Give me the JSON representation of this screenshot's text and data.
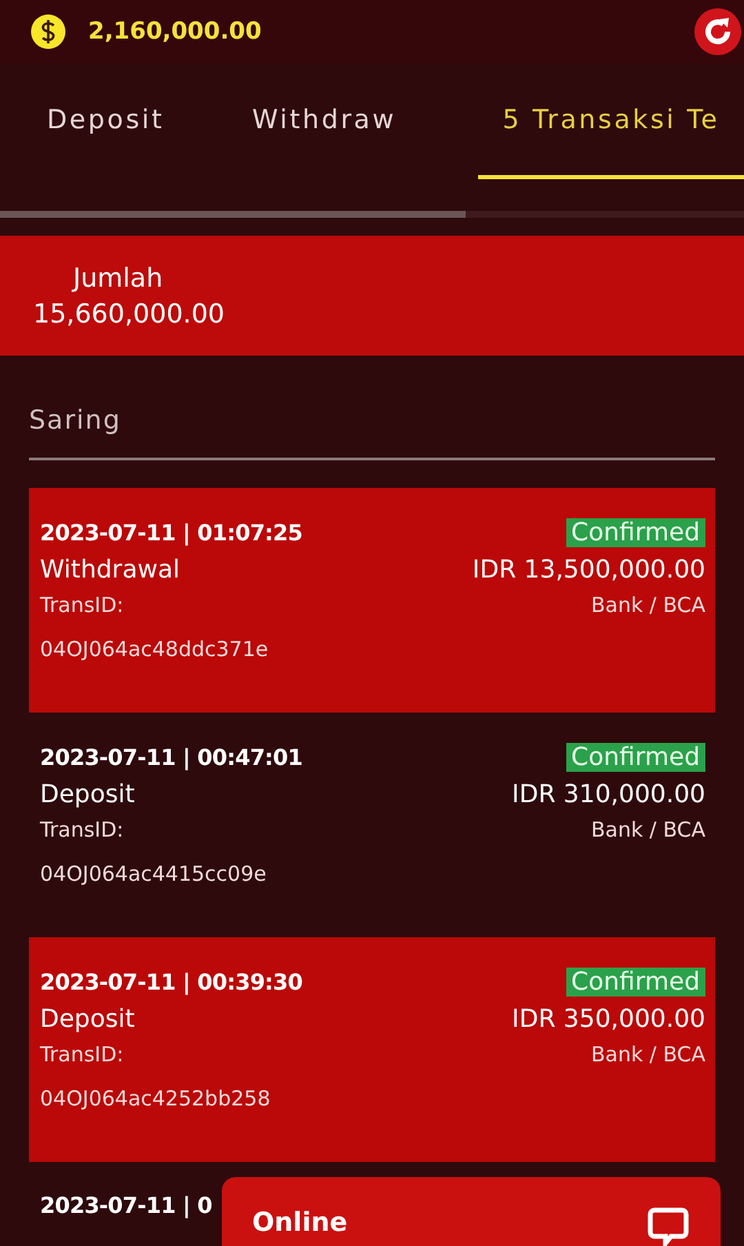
{
  "balance": "2,160,000.00",
  "tabs": [
    {
      "label": "Deposit",
      "selected": false
    },
    {
      "label": "Withdraw",
      "selected": false
    },
    {
      "label": "5 Transaksi Te",
      "selected": true
    }
  ],
  "summary": {
    "label": "Jumlah",
    "value": "15,660,000.00"
  },
  "filter": {
    "label": "Saring"
  },
  "transactions": [
    {
      "highlighted": true,
      "datetime": "2023-07-11 | 01:07:25",
      "status": "Confirmed",
      "type": "Withdrawal",
      "amount": "IDR 13,500,000.00",
      "id_label": "TransID:",
      "method": "Bank / BCA",
      "id": "04OJ064ac48ddc371e"
    },
    {
      "highlighted": false,
      "datetime": "2023-07-11 | 00:47:01",
      "status": "Confirmed",
      "type": "Deposit",
      "amount": "IDR 310,000.00",
      "id_label": "TransID:",
      "method": "Bank / BCA",
      "id": "04OJ064ac4415cc09e"
    },
    {
      "highlighted": true,
      "datetime": "2023-07-11 | 00:39:30",
      "status": "Confirmed",
      "type": "Deposit",
      "amount": "IDR 350,000.00",
      "id_label": "TransID:",
      "method": "Bank / BCA",
      "id": "04OJ064ac4252bb258"
    },
    {
      "highlighted": false,
      "datetime": "2023-07-11 | 0"
    }
  ],
  "chat": {
    "label": "Online"
  }
}
